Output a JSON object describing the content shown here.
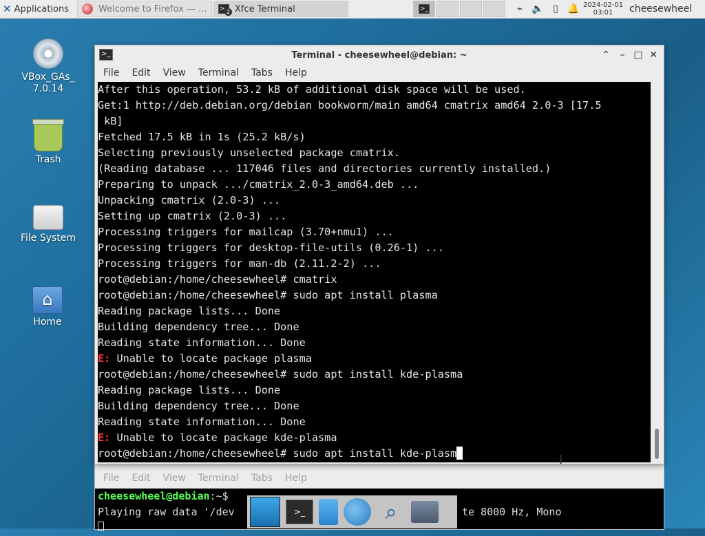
{
  "panel": {
    "apps_label": "Applications",
    "tasks": [
      {
        "label": "Welcome to Firefox — ..."
      },
      {
        "label": "Xfce Terminal",
        "badge": "2"
      }
    ],
    "clock_date": "2024-02-01",
    "clock_time": "03:01",
    "user": "cheesewheel"
  },
  "desktop": {
    "icons": [
      {
        "label": "VBox_GAs_7.0.14"
      },
      {
        "label": "Trash"
      },
      {
        "label": "File System"
      },
      {
        "label": "Home"
      }
    ]
  },
  "window": {
    "title": "Terminal - cheesewheel@debian: ~",
    "menu": [
      "File",
      "Edit",
      "View",
      "Terminal",
      "Tabs",
      "Help"
    ]
  },
  "terminal": {
    "lines": [
      {
        "text": "After this operation, 53.2 kB of additional disk space will be used."
      },
      {
        "text": "Get:1 http://deb.debian.org/debian bookworm/main amd64 cmatrix amd64 2.0-3 [17.5"
      },
      {
        "text": " kB]"
      },
      {
        "text": "Fetched 17.5 kB in 1s (25.2 kB/s)"
      },
      {
        "text": "Selecting previously unselected package cmatrix."
      },
      {
        "text": "(Reading database ... 117046 files and directories currently installed.)"
      },
      {
        "text": "Preparing to unpack .../cmatrix_2.0-3_amd64.deb ..."
      },
      {
        "text": "Unpacking cmatrix (2.0-3) ..."
      },
      {
        "text": "Setting up cmatrix (2.0-3) ..."
      },
      {
        "text": "Processing triggers for mailcap (3.70+nmu1) ..."
      },
      {
        "text": "Processing triggers for desktop-file-utils (0.26-1) ..."
      },
      {
        "text": "Processing triggers for man-db (2.11.2-2) ..."
      },
      {
        "text": "root@debian:/home/cheesewheel# cmatrix"
      },
      {
        "text": "root@debian:/home/cheesewheel# sudo apt install plasma"
      },
      {
        "text": "Reading package lists... Done"
      },
      {
        "text": "Building dependency tree... Done"
      },
      {
        "text": "Reading state information... Done"
      },
      {
        "prefix": "E:",
        "text": " Unable to locate package plasma"
      },
      {
        "text": "root@debian:/home/cheesewheel# sudo apt install kde-plasma"
      },
      {
        "text": "Reading package lists... Done"
      },
      {
        "text": "Building dependency tree... Done"
      },
      {
        "text": "Reading state information... Done"
      },
      {
        "prefix": "E:",
        "text": " Unable to locate package kde-plasma"
      },
      {
        "text": "root@debian:/home/cheesewheel# sudo apt install kde-plasm"
      }
    ]
  },
  "back_terminal": {
    "menu": [
      "File",
      "Edit",
      "View",
      "Terminal",
      "Tabs",
      "Help"
    ],
    "prompt_user": "cheesewheel@debian",
    "prompt_path": ":~$",
    "line2_left": "Playing raw data '/dev",
    "line2_right": "te 8000 Hz, Mono"
  },
  "colors": {
    "error": "#ff3030",
    "prompt_green": "#55ff55",
    "desktop_blue": "#1e6d9c"
  }
}
